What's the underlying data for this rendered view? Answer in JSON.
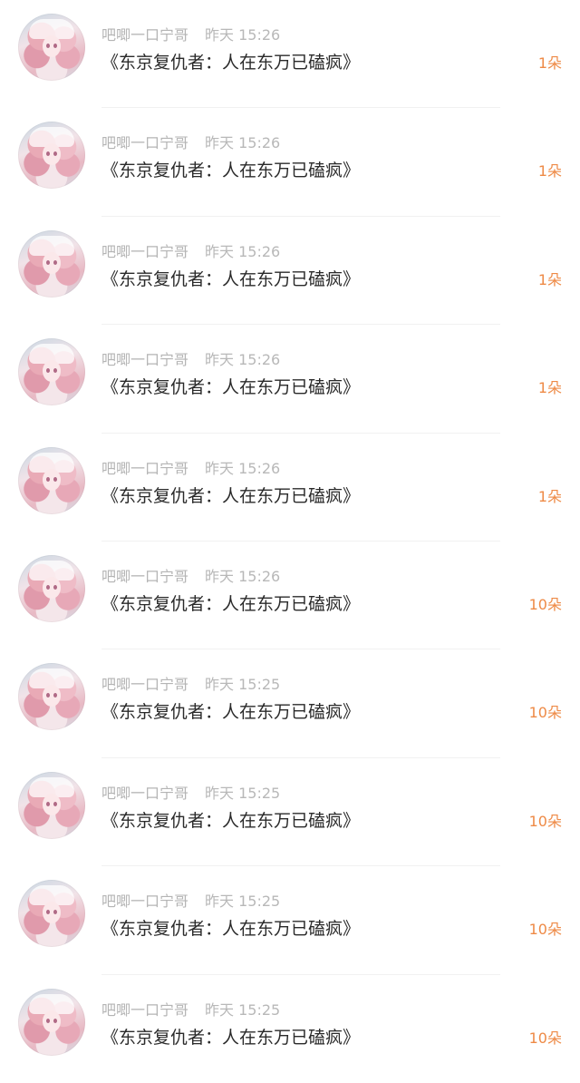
{
  "items": [
    {
      "username": "吧唧一口宁哥",
      "time": "昨天 15:26",
      "title": "《东京复仇者：人在东万已磕疯》",
      "gift": "1朵"
    },
    {
      "username": "吧唧一口宁哥",
      "time": "昨天 15:26",
      "title": "《东京复仇者：人在东万已磕疯》",
      "gift": "1朵"
    },
    {
      "username": "吧唧一口宁哥",
      "time": "昨天 15:26",
      "title": "《东京复仇者：人在东万已磕疯》",
      "gift": "1朵"
    },
    {
      "username": "吧唧一口宁哥",
      "time": "昨天 15:26",
      "title": "《东京复仇者：人在东万已磕疯》",
      "gift": "1朵"
    },
    {
      "username": "吧唧一口宁哥",
      "time": "昨天 15:26",
      "title": "《东京复仇者：人在东万已磕疯》",
      "gift": "1朵"
    },
    {
      "username": "吧唧一口宁哥",
      "time": "昨天 15:26",
      "title": "《东京复仇者：人在东万已磕疯》",
      "gift": "10朵"
    },
    {
      "username": "吧唧一口宁哥",
      "time": "昨天 15:25",
      "title": "《东京复仇者：人在东万已磕疯》",
      "gift": "10朵"
    },
    {
      "username": "吧唧一口宁哥",
      "time": "昨天 15:25",
      "title": "《东京复仇者：人在东万已磕疯》",
      "gift": "10朵"
    },
    {
      "username": "吧唧一口宁哥",
      "time": "昨天 15:25",
      "title": "《东京复仇者：人在东万已磕疯》",
      "gift": "10朵"
    },
    {
      "username": "吧唧一口宁哥",
      "time": "昨天 15:25",
      "title": "《东京复仇者：人在东万已磕疯》",
      "gift": "10朵"
    }
  ],
  "colors": {
    "gift": "#ee8a46",
    "meta": "#b4b4b4",
    "title": "#2a2a2a"
  }
}
